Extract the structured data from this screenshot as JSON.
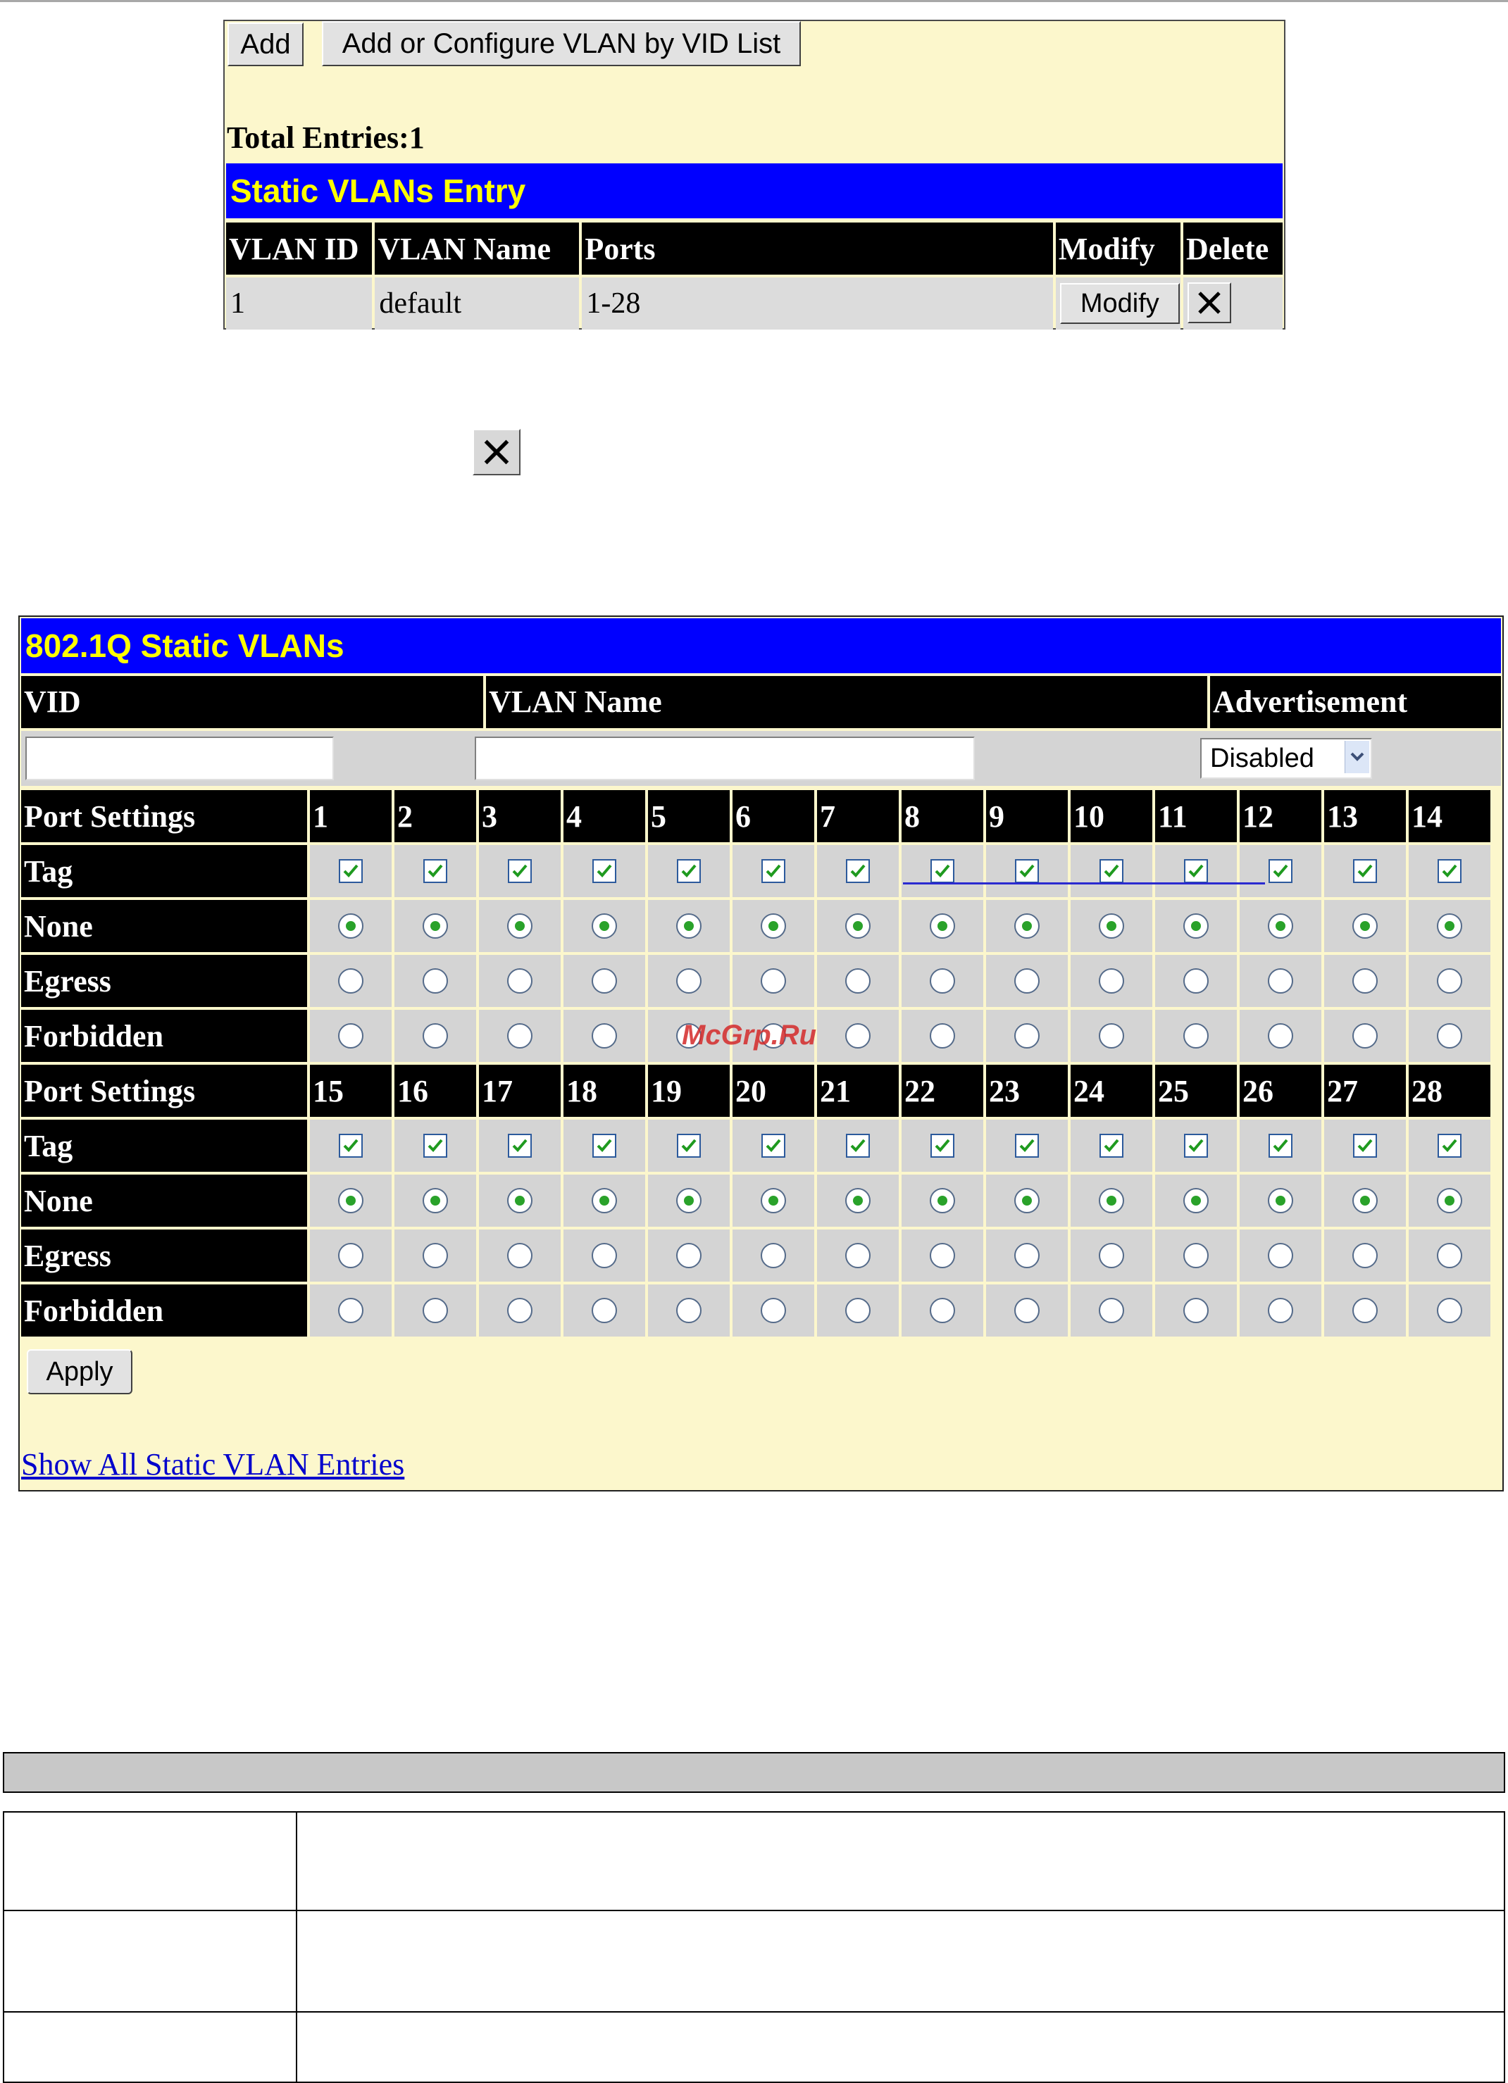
{
  "top_panel": {
    "add_label": "Add",
    "add_vid_list_label": "Add or Configure VLAN by VID List",
    "total_entries": "Total Entries:1",
    "title": "Static VLANs Entry",
    "headers": [
      "VLAN ID",
      "VLAN Name",
      "Ports",
      "Modify",
      "Delete"
    ],
    "rows": [
      {
        "vlan_id": "1",
        "vlan_name": "default",
        "ports": "1-28",
        "modify_label": "Modify"
      }
    ]
  },
  "main_panel": {
    "title": "802.1Q Static VLANs",
    "vid_label": "VID",
    "vlan_name_label": "VLAN Name",
    "advertisement_label": "Advertisement",
    "vid_value": "",
    "vlan_name_value": "",
    "advertisement_value": "Disabled",
    "port_settings_label": "Port Settings",
    "row_labels": [
      "Tag",
      "None",
      "Egress",
      "Forbidden"
    ],
    "port_groups": [
      [
        "1",
        "2",
        "3",
        "4",
        "5",
        "6",
        "7",
        "8",
        "9",
        "10",
        "11",
        "12",
        "13",
        "14"
      ],
      [
        "15",
        "16",
        "17",
        "18",
        "19",
        "20",
        "21",
        "22",
        "23",
        "24",
        "25",
        "26",
        "27",
        "28"
      ]
    ],
    "apply_label": "Apply",
    "show_all_link": "Show All Static VLAN Entries"
  },
  "watermark": "McGrp.Ru",
  "colors": {
    "title_bar_bg": "#0000ff",
    "title_bar_text": "#ffff00",
    "header_bg": "#000000",
    "panel_bg": "#fcf7cc",
    "radio_selected": "#2aa22a"
  }
}
